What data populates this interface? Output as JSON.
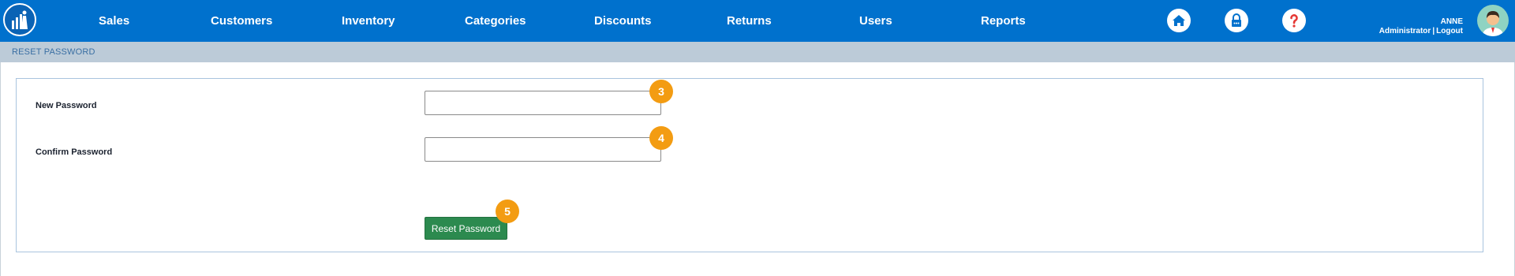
{
  "nav": {
    "items": [
      "Sales",
      "Customers",
      "Inventory",
      "Categories",
      "Discounts",
      "Returns",
      "Users",
      "Reports"
    ],
    "icons": [
      "home-icon",
      "lock-icon",
      "help-icon"
    ]
  },
  "user": {
    "name": "ANNE",
    "role": "Administrator",
    "separator": "|",
    "logout": "Logout"
  },
  "subheader": {
    "title": "RESET PASSWORD"
  },
  "form": {
    "new_password": {
      "label": "New Password",
      "value": ""
    },
    "confirm_password": {
      "label": "Confirm Password",
      "value": ""
    },
    "submit_label": "Reset Password"
  },
  "markers": [
    "3",
    "4",
    "5"
  ],
  "colors": {
    "topbar": "#0071cd",
    "subbar": "#bccbd8",
    "button": "#2c8a4f",
    "marker": "#f39c12"
  }
}
